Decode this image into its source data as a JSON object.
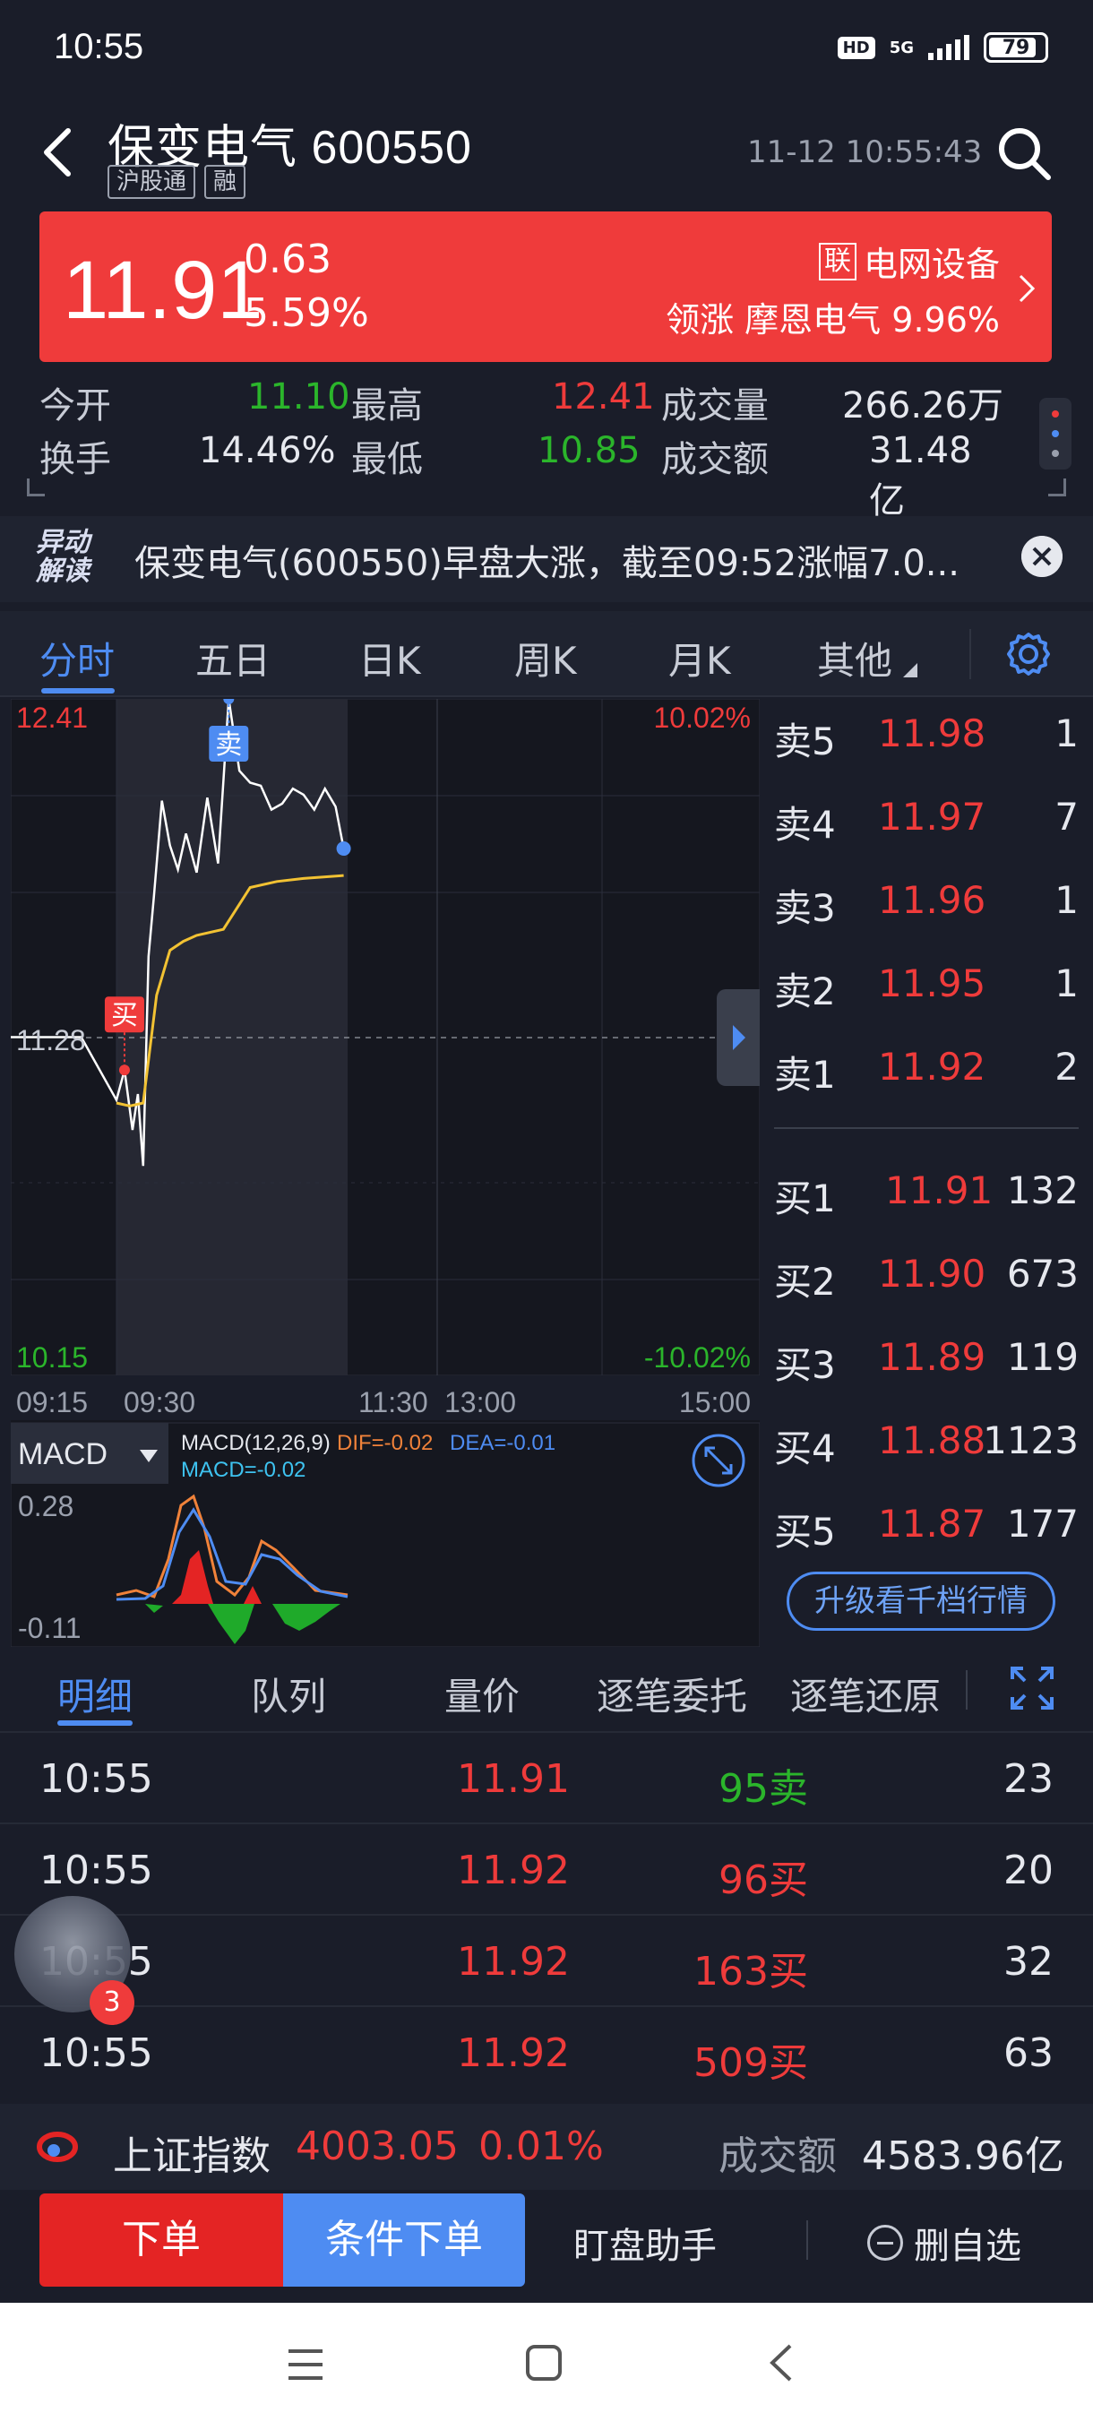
{
  "status_bar": {
    "time": "10:55",
    "hd": "HD",
    "network": "5G",
    "battery": "79"
  },
  "header": {
    "title": "保变电气 600550",
    "tags": [
      "沪股通",
      "融"
    ],
    "datetime": "11-12 10:55:43"
  },
  "quote": {
    "price": "11.91",
    "change": "0.63",
    "change_pct": "5.59%",
    "sector_badge": "联",
    "sector": "电网设备",
    "lead_label": "领涨",
    "lead_stock": "摩恩电气",
    "lead_pct": "9.96%"
  },
  "stats": {
    "open_label": "今开",
    "open": "11.10",
    "high_label": "最高",
    "high": "12.41",
    "volume_label": "成交量",
    "volume": "266.26万",
    "turnover_label": "换手",
    "turnover": "14.46%",
    "low_label": "最低",
    "low": "10.85",
    "amount_label": "成交额",
    "amount": "31.48亿"
  },
  "news": {
    "logo_line1": "异动",
    "logo_line2": "解读",
    "text": "保变电气(600550)早盘大涨，截至09:52涨幅7.0..."
  },
  "chart_tabs": [
    "分时",
    "五日",
    "日K",
    "周K",
    "月K",
    "其他"
  ],
  "chart_data": {
    "type": "line",
    "title": "",
    "price_axis": {
      "top": "12.41",
      "mid": "11.28",
      "bottom": "10.15"
    },
    "pct_axis": {
      "top": "10.02%",
      "bottom": "-10.02%"
    },
    "time_labels": [
      "09:15",
      "09:30",
      "11:30",
      "13:00",
      "15:00"
    ],
    "ylim": [
      10.15,
      12.41
    ],
    "prev_close": 11.28,
    "series": [
      {
        "name": "price",
        "color": "#ffffff",
        "x": [
          "09:15",
          "09:25",
          "09:30",
          "09:33",
          "09:36",
          "09:38",
          "09:40",
          "09:42",
          "09:44",
          "09:47",
          "09:50",
          "09:53",
          "09:56",
          "10:00",
          "10:04",
          "10:08",
          "10:12",
          "10:16",
          "10:20",
          "10:24",
          "10:28",
          "10:32",
          "10:36",
          "10:40",
          "10:44",
          "10:48",
          "10:52",
          "10:55"
        ],
        "values": [
          11.28,
          11.28,
          11.07,
          11.17,
          10.97,
          11.09,
          10.85,
          11.55,
          11.75,
          12.07,
          11.92,
          11.84,
          11.96,
          11.83,
          12.08,
          11.86,
          12.41,
          12.17,
          12.13,
          12.12,
          12.04,
          12.06,
          12.11,
          12.09,
          12.04,
          12.11,
          12.05,
          11.91
        ]
      },
      {
        "name": "avg",
        "color": "#f2c233",
        "x": [
          "09:30",
          "09:35",
          "09:40",
          "09:45",
          "09:50",
          "09:55",
          "10:00",
          "10:10",
          "10:20",
          "10:30",
          "10:40",
          "10:55"
        ],
        "values": [
          11.06,
          11.05,
          11.06,
          11.42,
          11.57,
          11.6,
          11.62,
          11.64,
          11.78,
          11.8,
          11.81,
          11.82
        ]
      }
    ],
    "markers": [
      {
        "label": "买",
        "time": "09:33",
        "price": 11.17
      },
      {
        "label": "卖",
        "time": "10:12",
        "price": 12.41
      }
    ]
  },
  "macd": {
    "selector": "MACD",
    "params": "MACD(12,26,9)",
    "dif": "DIF=-0.02",
    "dea": "DEA=-0.01",
    "macd": "MACD=-0.02",
    "ymax": "0.28",
    "ymin": "-0.11"
  },
  "orderbook": {
    "asks": [
      {
        "label": "卖5",
        "price": "11.98",
        "volume": "1"
      },
      {
        "label": "卖4",
        "price": "11.97",
        "volume": "7"
      },
      {
        "label": "卖3",
        "price": "11.96",
        "volume": "1"
      },
      {
        "label": "卖2",
        "price": "11.95",
        "volume": "1"
      },
      {
        "label": "卖1",
        "price": "11.92",
        "volume": "2"
      }
    ],
    "bids": [
      {
        "label": "买1",
        "price": "11.91",
        "volume": "132"
      },
      {
        "label": "买2",
        "price": "11.90",
        "volume": "673"
      },
      {
        "label": "买3",
        "price": "11.89",
        "volume": "119"
      },
      {
        "label": "买4",
        "price": "11.88",
        "volume": "1123"
      },
      {
        "label": "买5",
        "price": "11.87",
        "volume": "177"
      }
    ],
    "upgrade_label": "升级看千档行情"
  },
  "detail_tabs": [
    "明细",
    "队列",
    "量价",
    "逐笔委托",
    "逐笔还原"
  ],
  "trades": [
    {
      "time": "10:55",
      "price": "11.91",
      "qty": "95卖",
      "count": "23",
      "side": "sell"
    },
    {
      "time": "10:55",
      "price": "11.92",
      "qty": "96买",
      "count": "20",
      "side": "buy"
    },
    {
      "time": "10:55",
      "price": "11.92",
      "qty": "163买",
      "count": "32",
      "side": "buy"
    },
    {
      "time": "10:55",
      "price": "11.92",
      "qty": "509买",
      "count": "63",
      "side": "buy"
    }
  ],
  "avatar_badge": "3",
  "index_bar": {
    "name": "上证指数",
    "value": "4003.05",
    "pct": "0.01%",
    "amount_label": "成交额",
    "amount": "4583.96亿"
  },
  "actions": {
    "order": "下单",
    "cond_order": "条件下单",
    "watch": "盯盘助手",
    "remove": "删自选"
  },
  "colors": {
    "up": "#ef3b3b",
    "down": "#2bb52b",
    "accent": "#4e8cf2",
    "avg_line": "#f2c233"
  }
}
